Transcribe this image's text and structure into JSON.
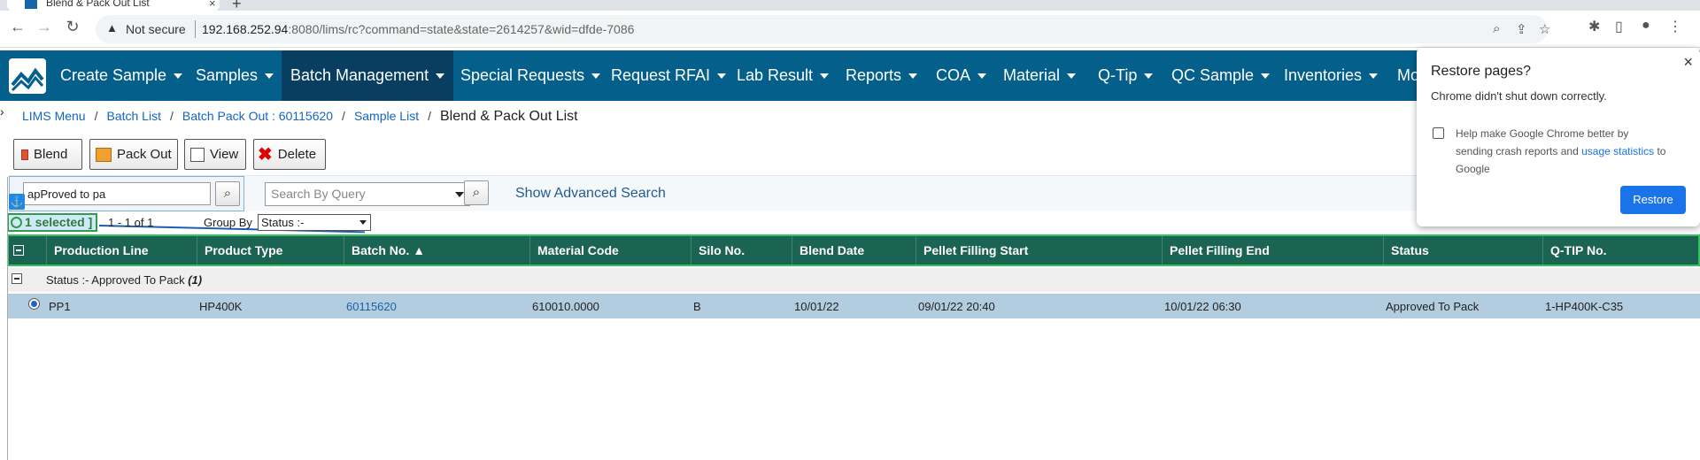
{
  "browser": {
    "tab_title": "Blend & Pack Out List",
    "tab_close": "×",
    "new_tab": "+",
    "not_secure": "Not secure",
    "url_host": "192.168.252.94",
    "url_rest": ":8080/lims/rc?command=state&state=2614257&wid=dfde-7086"
  },
  "nav": {
    "items": [
      {
        "label": "Create Sample"
      },
      {
        "label": "Samples"
      },
      {
        "label": "Batch Management"
      },
      {
        "label": "Special Requests"
      },
      {
        "label": "Request RFAI"
      },
      {
        "label": "Lab Result"
      },
      {
        "label": "Reports"
      },
      {
        "label": "COA"
      },
      {
        "label": "Material"
      },
      {
        "label": "Q-Tip"
      },
      {
        "label": "QC Sample"
      },
      {
        "label": "Inventories"
      },
      {
        "label": "Mo"
      }
    ],
    "active": "Batch Management"
  },
  "breadcrumb": {
    "items": [
      "LIMS Menu",
      "Batch List",
      "Batch Pack Out : 60115620",
      "Sample List"
    ],
    "separator": "/",
    "current": "Blend & Pack Out List"
  },
  "actions": {
    "blend": "Blend",
    "pack_out": "Pack Out",
    "view": "View",
    "delete": "Delete"
  },
  "search": {
    "quick_value": "apProved to pa",
    "query_placeholder": "Search By Query",
    "advanced": "Show Advanced Search"
  },
  "selection": {
    "selected": "1 selected ]",
    "paging": "1 - 1 of 1",
    "group_by_label": "Group By",
    "group_by_value": "Status :-"
  },
  "table": {
    "columns": [
      "Production Line",
      "Product Type",
      "Batch No. ▲",
      "Material Code",
      "Silo No.",
      "Blend Date",
      "Pellet Filling Start",
      "Pellet Filling End",
      "Status",
      "Q-TIP No."
    ],
    "group_label": "Status :- Approved To Pack",
    "group_count": "(1)",
    "rows": [
      {
        "production_line": "PP1",
        "product_type": "HP400K",
        "batch_no": "60115620",
        "material_code": "610010.0000",
        "silo_no": "B",
        "blend_date": "10/01/22",
        "filling_start": "09/01/22 20:40",
        "filling_end": "10/01/22 06:30",
        "status": "Approved To Pack",
        "qtip_no": "1-HP400K-C35"
      }
    ]
  },
  "popup": {
    "title": "Restore pages?",
    "message": "Chrome didn't shut down correctly.",
    "help_prefix": "Help make Google Chrome better by sending crash reports and ",
    "help_link": "usage statistics",
    "help_suffix": " to Google",
    "restore_button": "Restore",
    "close": "×"
  },
  "colors": {
    "nav_bg": "#045f8a",
    "nav_active": "#083e60",
    "grid_header": "#1b6454",
    "row_selected": "#b3cde0",
    "restore_btn": "#1a73e8"
  }
}
